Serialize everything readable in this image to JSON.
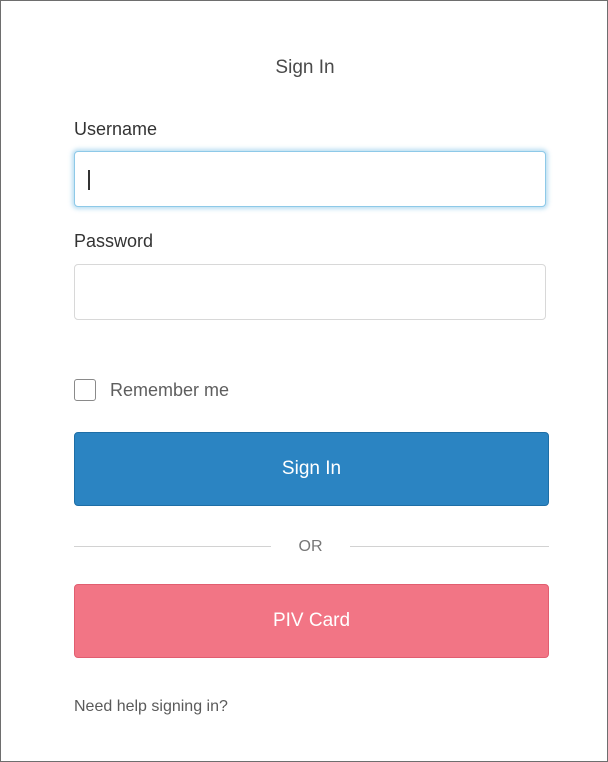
{
  "form": {
    "title": "Sign In",
    "username_label": "Username",
    "username_value": "",
    "password_label": "Password",
    "password_value": "",
    "remember_label": "Remember me",
    "remember_checked": false,
    "signin_button": "Sign In",
    "divider_text": "OR",
    "piv_button": "PIV Card",
    "help_link": "Need help signing in?"
  },
  "colors": {
    "primary": "#2b84c2",
    "piv": "#f27585",
    "focus_ring": "#8ec9e8"
  }
}
